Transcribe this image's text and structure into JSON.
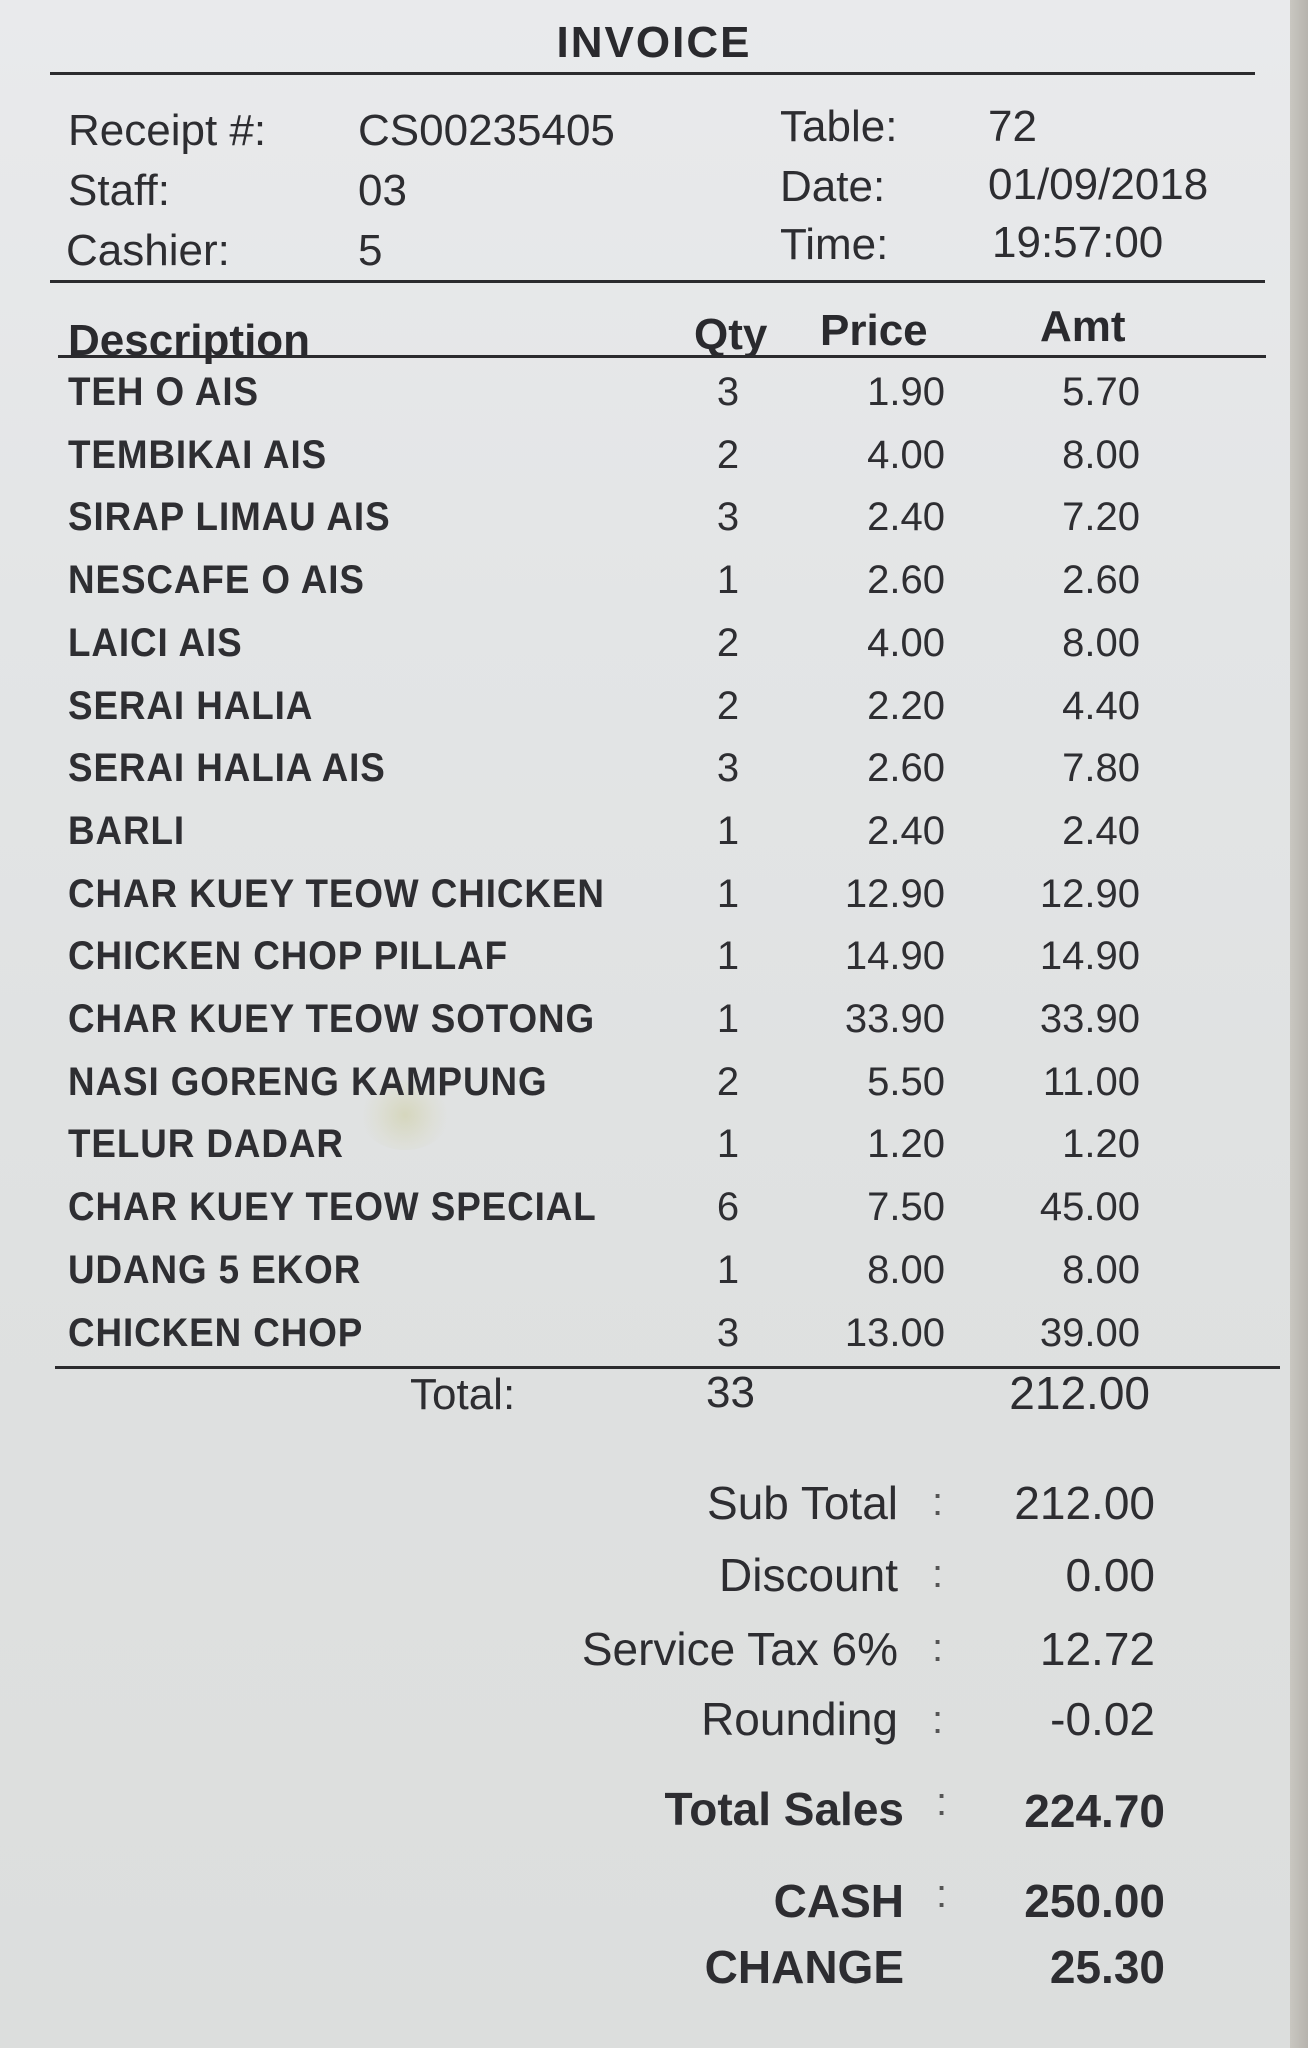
{
  "invoice": {
    "title": "INVOICE",
    "receipt_label": "Receipt #:",
    "receipt_no": "CS00235405",
    "staff_label": "Staff:",
    "staff": "03",
    "cashier_label": "Cashier:",
    "cashier": "5",
    "table_label": "Table:",
    "table": "72",
    "date_label": "Date:",
    "date": "01/09/2018",
    "time_label": "Time:",
    "time": "19:57:00"
  },
  "columns": {
    "description": "Description",
    "qty": "Qty",
    "price": "Price",
    "amt": "Amt"
  },
  "items": [
    {
      "desc": "TEH O AIS",
      "qty": "3",
      "price": "1.90",
      "amt": "5.70"
    },
    {
      "desc": "TEMBIKAI AIS",
      "qty": "2",
      "price": "4.00",
      "amt": "8.00"
    },
    {
      "desc": "SIRAP LIMAU AIS",
      "qty": "3",
      "price": "2.40",
      "amt": "7.20"
    },
    {
      "desc": "NESCAFE O AIS",
      "qty": "1",
      "price": "2.60",
      "amt": "2.60"
    },
    {
      "desc": "LAICI AIS",
      "qty": "2",
      "price": "4.00",
      "amt": "8.00"
    },
    {
      "desc": "SERAI HALIA",
      "qty": "2",
      "price": "2.20",
      "amt": "4.40"
    },
    {
      "desc": "SERAI HALIA AIS",
      "qty": "3",
      "price": "2.60",
      "amt": "7.80"
    },
    {
      "desc": "BARLI",
      "qty": "1",
      "price": "2.40",
      "amt": "2.40"
    },
    {
      "desc": "CHAR KUEY TEOW CHICKEN",
      "qty": "1",
      "price": "12.90",
      "amt": "12.90"
    },
    {
      "desc": "CHICKEN CHOP PILLAF",
      "qty": "1",
      "price": "14.90",
      "amt": "14.90"
    },
    {
      "desc": "CHAR KUEY TEOW SOTONG",
      "qty": "1",
      "price": "33.90",
      "amt": "33.90"
    },
    {
      "desc": "NASI GORENG KAMPUNG",
      "qty": "2",
      "price": "5.50",
      "amt": "11.00"
    },
    {
      "desc": "TELUR DADAR",
      "qty": "1",
      "price": "1.20",
      "amt": "1.20"
    },
    {
      "desc": "CHAR KUEY TEOW SPECIAL",
      "qty": "6",
      "price": "7.50",
      "amt": "45.00"
    },
    {
      "desc": "UDANG 5 EKOR",
      "qty": "1",
      "price": "8.00",
      "amt": "8.00"
    },
    {
      "desc": "CHICKEN CHOP",
      "qty": "3",
      "price": "13.00",
      "amt": "39.00"
    }
  ],
  "total": {
    "label": "Total:",
    "qty": "33",
    "amt": "212.00"
  },
  "summary": {
    "colon": ":",
    "sub_total_label": "Sub Total",
    "sub_total": "212.00",
    "discount_label": "Discount",
    "discount": "0.00",
    "service_tax_label": "Service Tax 6%",
    "service_tax": "12.72",
    "rounding_label": "Rounding",
    "rounding": "-0.02",
    "total_sales_label": "Total Sales",
    "total_sales": "224.70",
    "cash_label": "CASH",
    "cash": "250.00",
    "change_label": "CHANGE",
    "change": "25.30"
  }
}
